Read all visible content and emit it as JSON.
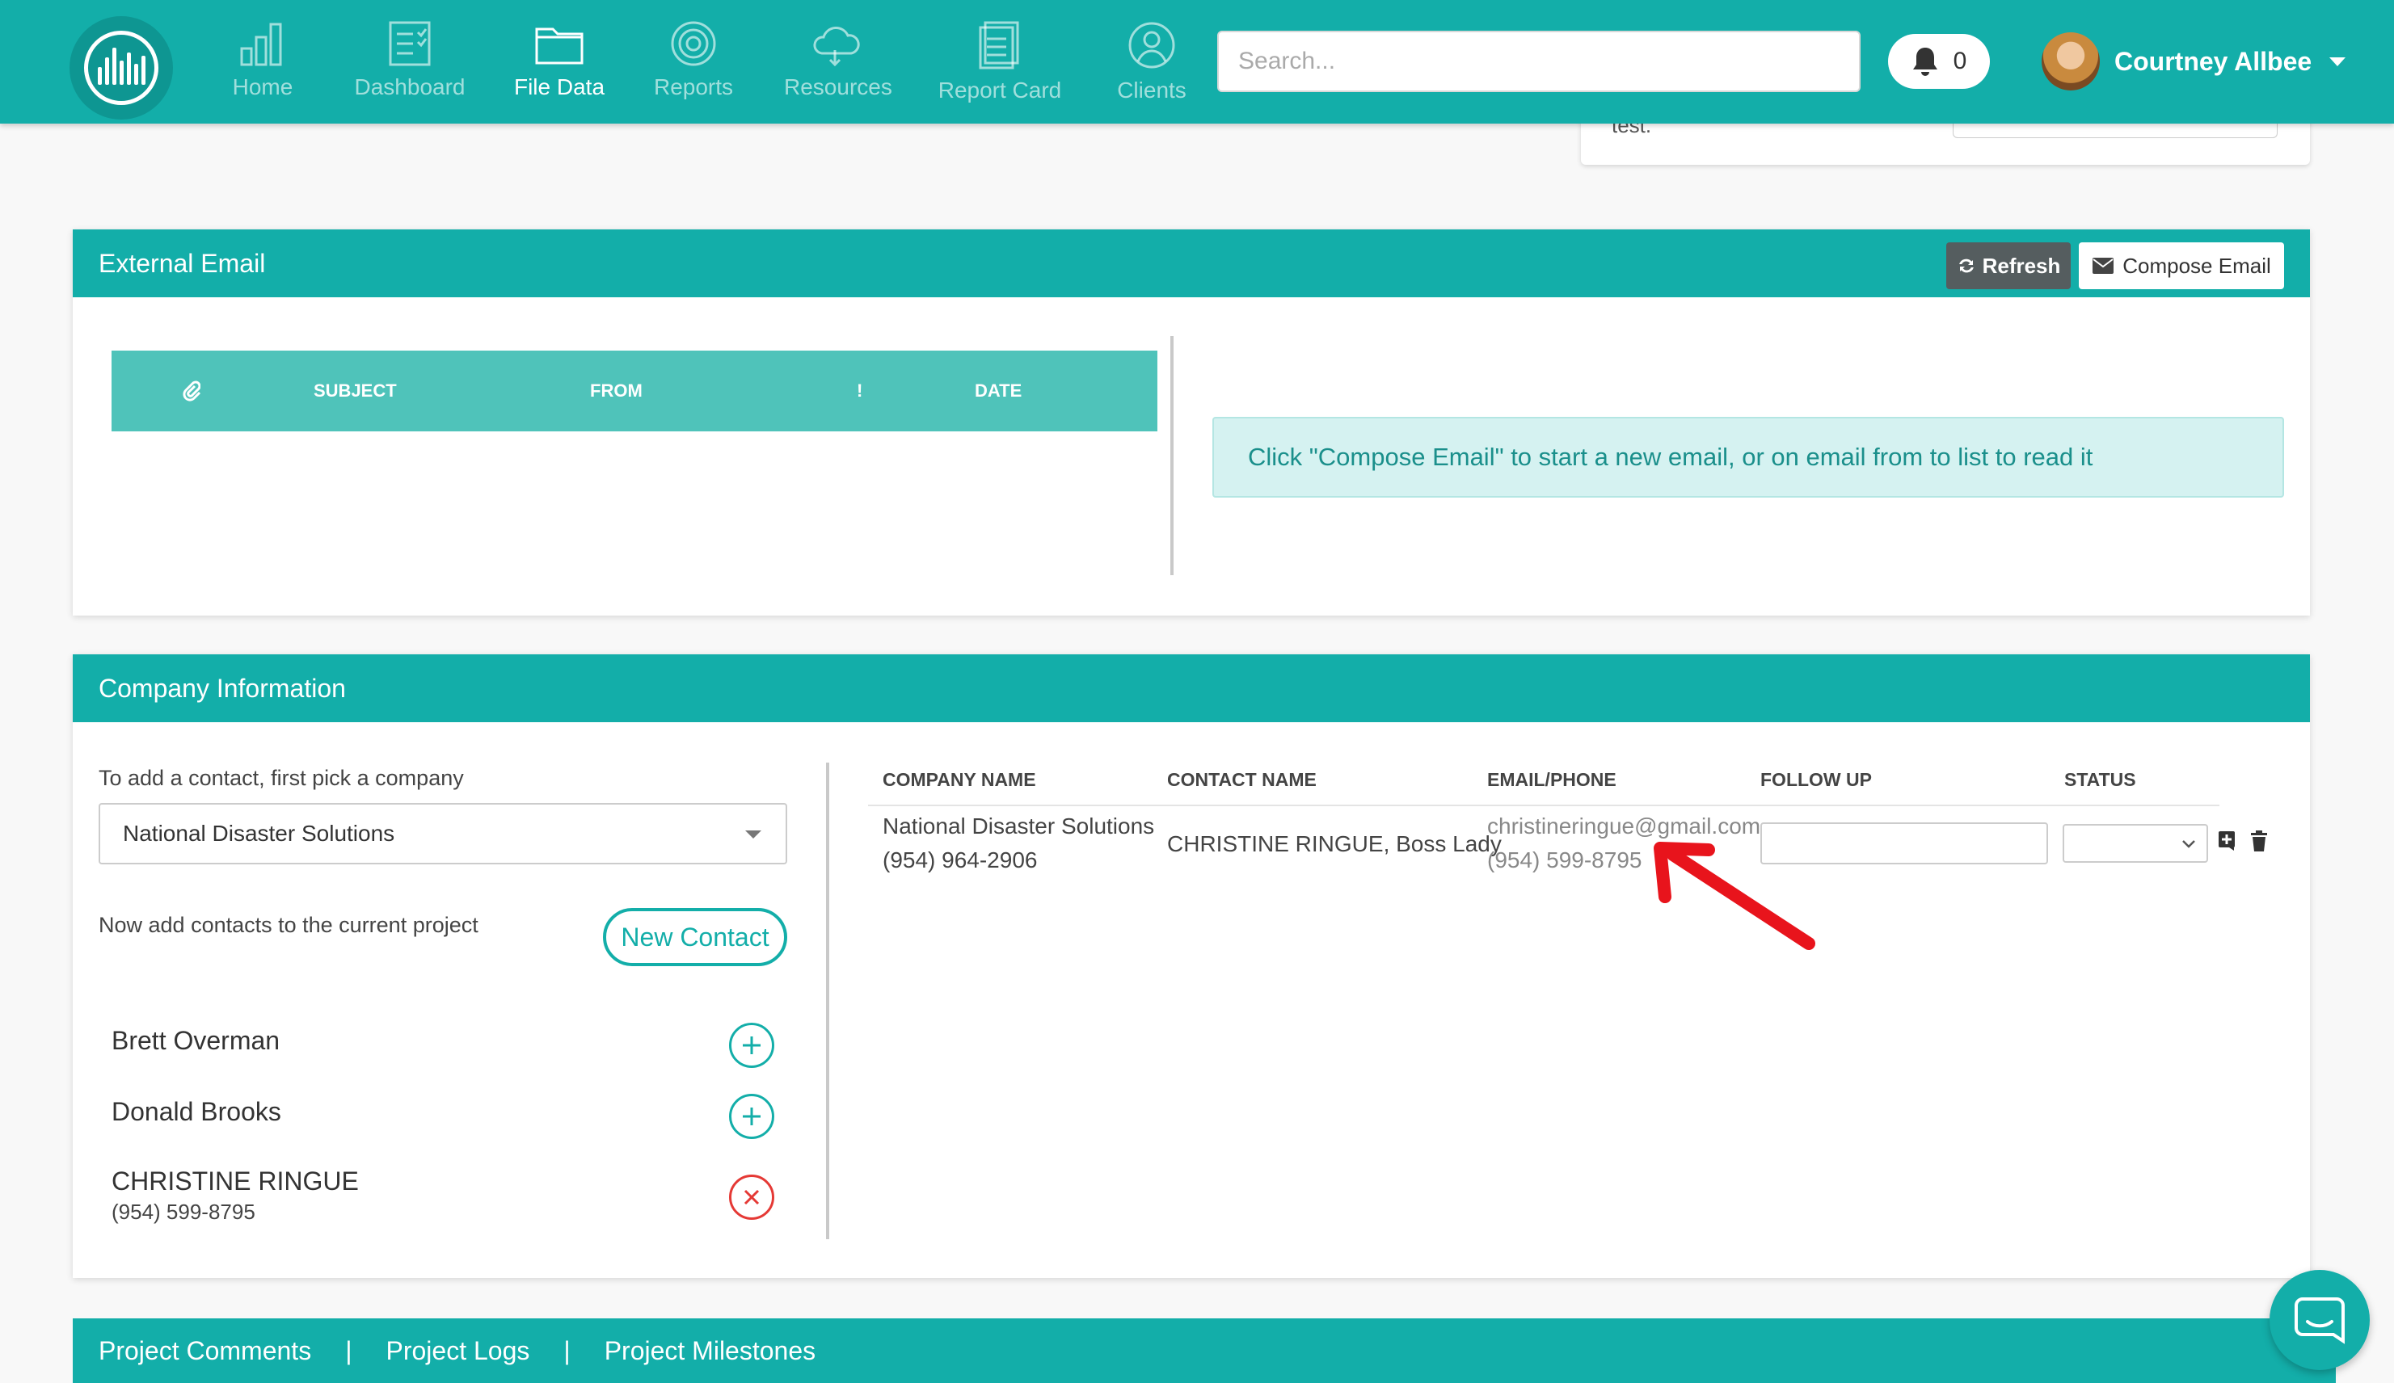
{
  "nav": {
    "items": [
      {
        "label": "Home",
        "icon": "bar-chart-icon"
      },
      {
        "label": "Dashboard",
        "icon": "checklist-icon"
      },
      {
        "label": "File Data",
        "icon": "folder-icon"
      },
      {
        "label": "Reports",
        "icon": "target-icon"
      },
      {
        "label": "Resources",
        "icon": "cloud-icon"
      },
      {
        "label": "Report Card",
        "icon": "document-icon"
      },
      {
        "label": "Clients",
        "icon": "user-circle-icon"
      }
    ],
    "active": "File Data",
    "search_placeholder": "Search...",
    "notification_count": "0",
    "user_name": "Courtney Allbee"
  },
  "prev_panel": {
    "text": "test."
  },
  "external_email": {
    "title": "External Email",
    "refresh_label": "Refresh",
    "compose_label": "Compose Email",
    "columns": {
      "subject": "SUBJECT",
      "from": "FROM",
      "importance": "!",
      "date": "DATE"
    },
    "info_text": "Click \"Compose Email\" to start a new email, or on email from to list to read it"
  },
  "company_info": {
    "title": "Company Information",
    "pick_label": "To add a contact, first pick a company",
    "selected_company": "National Disaster Solutions",
    "add_label": "Now add contacts to the current project",
    "new_contact_label": "New Contact",
    "contacts": [
      {
        "name": "Brett Overman"
      },
      {
        "name": "Donald Brooks"
      },
      {
        "name": "CHRISTINE RINGUE",
        "phone": "(954) 599-8795"
      }
    ],
    "table": {
      "headers": [
        "COMPANY NAME",
        "CONTACT NAME",
        "EMAIL/PHONE",
        "FOLLOW UP",
        "STATUS"
      ],
      "row": {
        "company": "National Disaster Solutions",
        "company_phone": "(954) 964-2906",
        "contact": "CHRISTINE RINGUE, Boss Lady",
        "email": "christineringue@gmail.com",
        "phone": "(954) 599-8795",
        "follow_up": "",
        "status": ""
      }
    }
  },
  "bottom_tabs": [
    "Project Comments",
    "Project Logs",
    "Project Milestones"
  ],
  "colors": {
    "primary": "#13aea9",
    "table_head": "#4fc3ba",
    "danger": "#e53935",
    "annotation": "#e8141c"
  }
}
